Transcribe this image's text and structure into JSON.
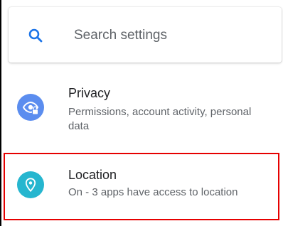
{
  "search": {
    "placeholder": "Search settings",
    "icon": "search-icon"
  },
  "items": [
    {
      "title": "Privacy",
      "summary": "Permissions, account activity, personal data",
      "icon": "privacy-eye-lock-icon",
      "icon_color": "#5b8def"
    },
    {
      "title": "Location",
      "summary": "On - 3 apps have access to location",
      "icon": "location-pin-icon",
      "icon_color": "#26b6cf"
    }
  ],
  "colors": {
    "accent": "#1a73e8",
    "highlight_border": "#e60000"
  }
}
